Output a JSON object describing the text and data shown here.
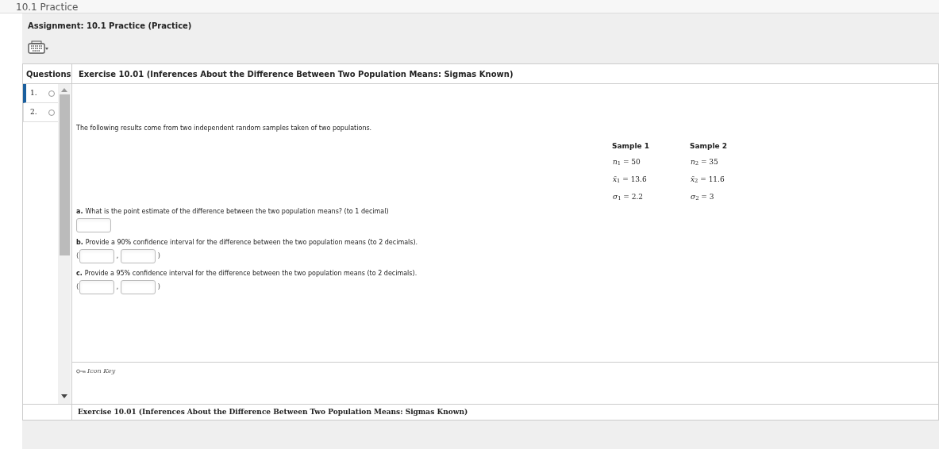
{
  "page_title": "10.1 Practice",
  "assignment": "Assignment: 10.1 Practice (Practice)",
  "questions_heading": "Questions",
  "exercise_title": "Exercise 10.01 (Inferences About the Difference Between Two Population Means: Sigmas Known)",
  "questions": [
    {
      "number": "1.",
      "selected": true,
      "answered": false
    },
    {
      "number": "2.",
      "selected": false,
      "answered": false
    }
  ],
  "intro": "The following results come from two independent random samples taken of two populations.",
  "samples": [
    {
      "heading": "Sample 1",
      "rows": [
        "*n*$_{1}$ = 50",
        "*x̄*$_{1}$ = 13.6",
        "*σ*$_{1}$ = 2.2"
      ]
    },
    {
      "heading": "Sample 2",
      "rows": [
        "*n*$_{2}$ = 35",
        "*x̄*$_{2}$ = 11.6",
        "*σ*$_{2}$ = 3"
      ]
    }
  ],
  "parts": [
    {
      "label": "a.",
      "text": "What is the point estimate of the difference between the two population means? (to 1 decimal)",
      "kind": "single"
    },
    {
      "label": "b.",
      "text": "Provide a 90% confidence interval for the difference between the two population means (to 2 decimals).",
      "kind": "interval",
      "open": "(",
      "sep": ",",
      "close": ")"
    },
    {
      "label": "c.",
      "text": "Provide a 95% confidence interval for the difference between the two population means (to 2 decimals).",
      "kind": "interval",
      "open": "(",
      "sep": ",",
      "close": ")"
    }
  ],
  "icon_key": "Icon Key",
  "footer_title": "Exercise 10.01 (Inferences About the Difference Between Two Population Means: Sigmas Known)"
}
